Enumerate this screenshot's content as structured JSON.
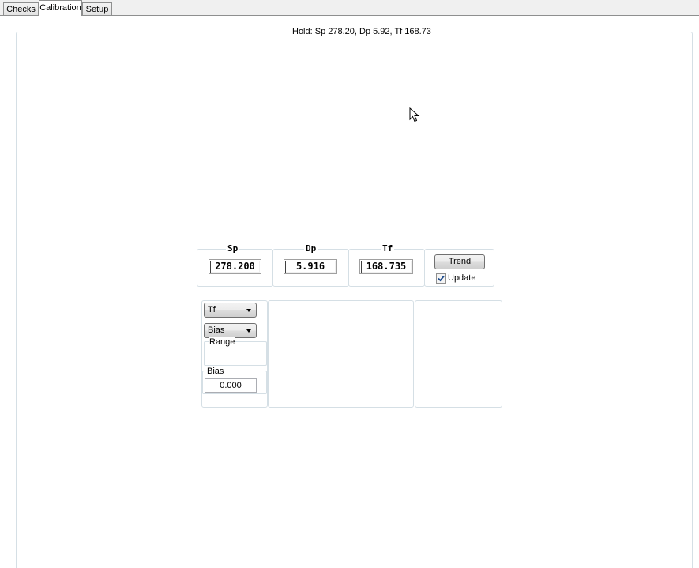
{
  "tabs": [
    {
      "label": "Checks"
    },
    {
      "label": "Calibration"
    },
    {
      "label": "Setup"
    }
  ],
  "hold_status": "Hold: Sp 278.20, Dp 5.92, Tf 168.73",
  "readouts": {
    "sp": {
      "title": "Sp",
      "value": "278.200"
    },
    "dp": {
      "title": "Dp",
      "value": "5.916"
    },
    "tf": {
      "title": "Tf",
      "value": "168.735"
    }
  },
  "trend_button": "Trend",
  "update_checkbox": {
    "label": "Update",
    "checked": true
  },
  "controls": {
    "variable_select": "Tf",
    "mode_select": "Bias",
    "range_label": "Range",
    "bias_label": "Bias",
    "bias_value": "0.000"
  },
  "icons": {
    "cursor": "mouse-pointer-icon",
    "check": "check-icon",
    "dropdown": "chevron-down-icon"
  }
}
